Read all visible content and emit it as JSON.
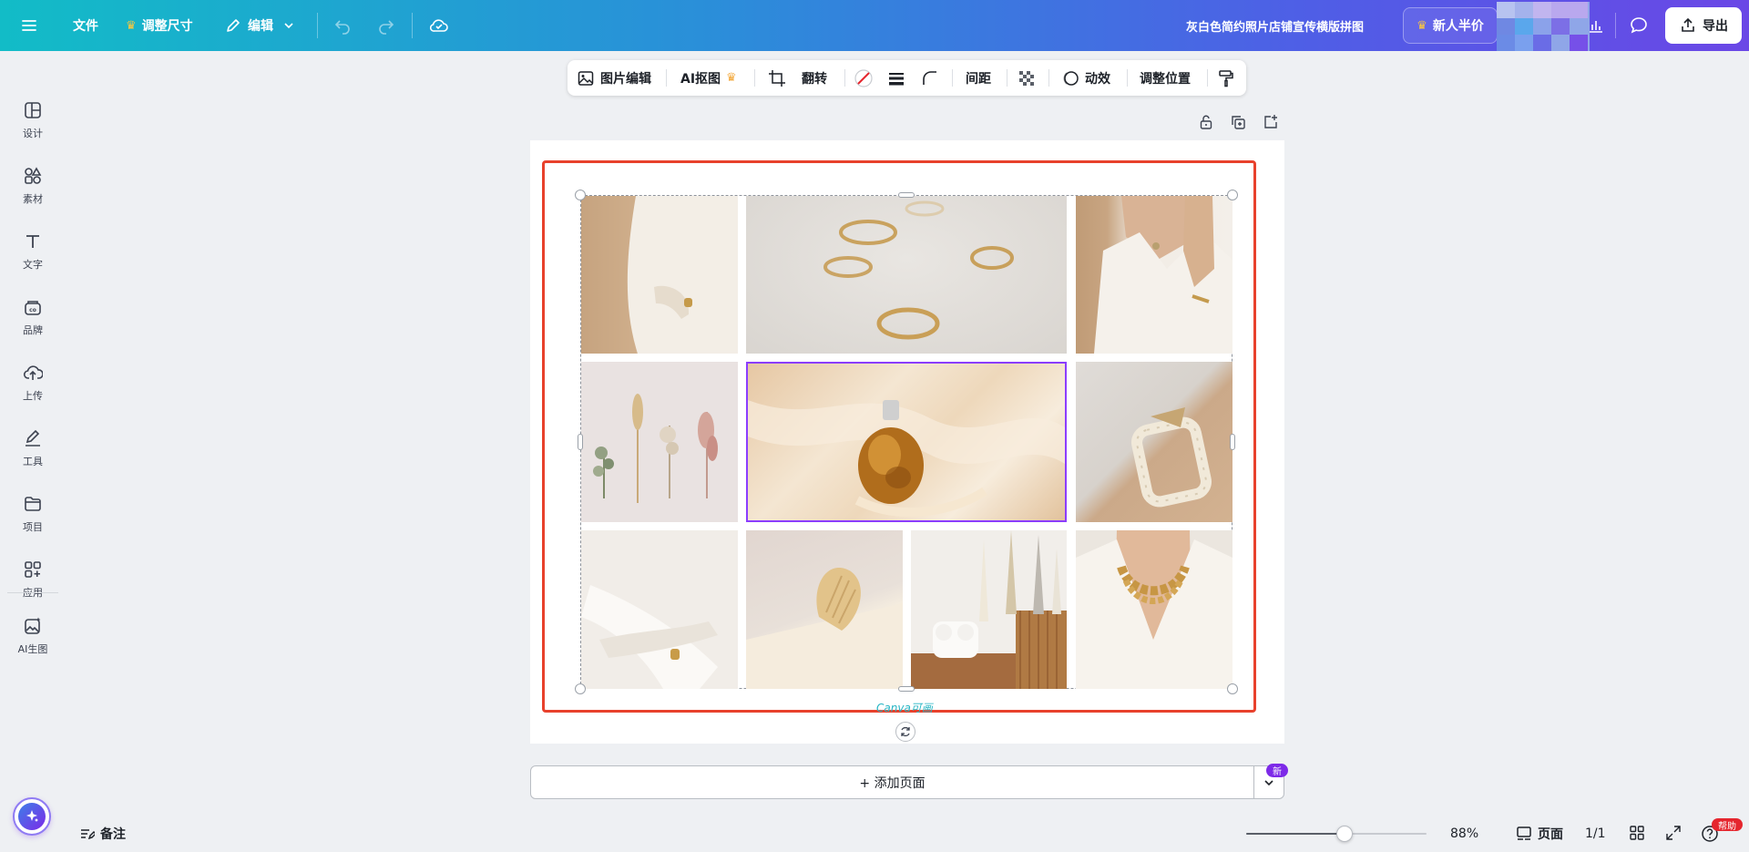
{
  "header": {
    "file_label": "文件",
    "resize_label": "调整尺寸",
    "edit_label": "编辑",
    "doc_title": "灰白色简约照片店铺宣传横版拼图",
    "promo_label": "新人半价",
    "export_label": "导出"
  },
  "sidebar": {
    "items": [
      {
        "label": "设计",
        "icon": "layout-icon"
      },
      {
        "label": "素材",
        "icon": "shapes-icon"
      },
      {
        "label": "文字",
        "icon": "text-icon"
      },
      {
        "label": "品牌",
        "icon": "brand-icon"
      },
      {
        "label": "上传",
        "icon": "upload-cloud-icon"
      },
      {
        "label": "工具",
        "icon": "pen-tool-icon"
      },
      {
        "label": "项目",
        "icon": "folder-icon"
      },
      {
        "label": "应用",
        "icon": "apps-icon"
      },
      {
        "label": "AI生图",
        "icon": "ai-image-icon"
      }
    ]
  },
  "toolbar": {
    "image_edit": "图片编辑",
    "ai_cutout": "AI抠图",
    "flip": "翻转",
    "spacing": "间距",
    "animate": "动效",
    "position": "调整位置"
  },
  "canvas": {
    "watermark": "Canva可画"
  },
  "bottom": {
    "add_page": "+ 添加页面",
    "new_badge": "新",
    "notes": "备注",
    "zoom": "88%",
    "zoom_level": 0.55,
    "pages_label": "页面",
    "page_count": "1/1",
    "help_badge": "帮助"
  },
  "colors": {
    "selection_red": "#e8412c",
    "selected_purple": "#8b3dff",
    "accent": "#7d2ae8"
  }
}
